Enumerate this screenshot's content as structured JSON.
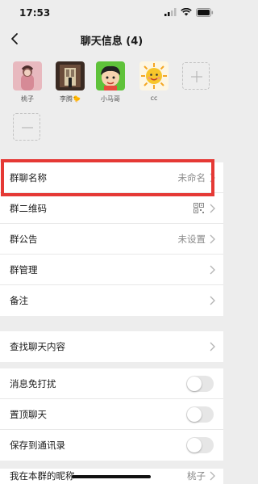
{
  "status": {
    "time": "17:53"
  },
  "nav": {
    "title": "聊天信息 (4)"
  },
  "members": [
    {
      "name": "桃子",
      "avatar": "photo-person-pink"
    },
    {
      "name": "李腾🐤",
      "avatar": "photo-doorway"
    },
    {
      "name": "小马哥",
      "avatar": "cartoon-boy-green"
    },
    {
      "name": "cc",
      "avatar": "sun-cartoon"
    }
  ],
  "section1": {
    "group_name_label": "群聊名称",
    "group_name_value": "未命名",
    "qr_label": "群二维码",
    "notice_label": "群公告",
    "notice_value": "未设置",
    "manage_label": "群管理",
    "remark_label": "备注"
  },
  "section2": {
    "search_label": "查找聊天内容"
  },
  "section3": {
    "dnd_label": "消息免打扰",
    "pin_label": "置顶聊天",
    "save_label": "保存到通讯录"
  },
  "section4": {
    "nickname_label": "我在本群的昵称",
    "nickname_value": "桃子"
  },
  "colors": {
    "highlight": "#e53935",
    "background": "#ededed"
  }
}
